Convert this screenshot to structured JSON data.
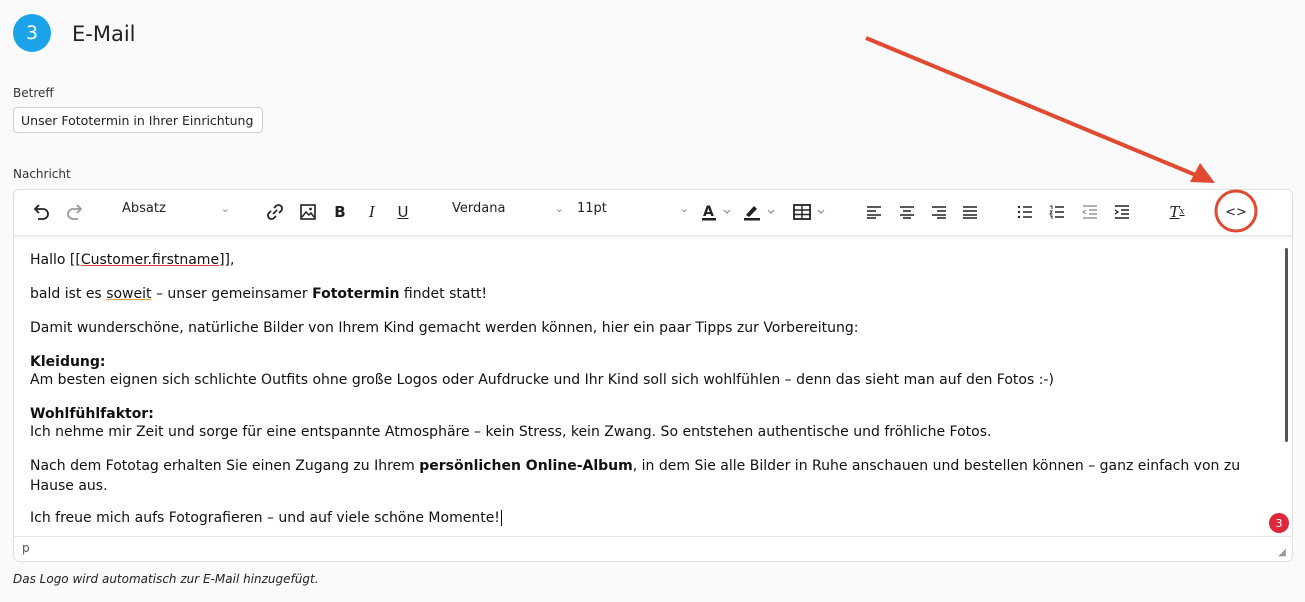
{
  "step": {
    "number": "3",
    "title": "E-Mail"
  },
  "subject": {
    "label": "Betreff",
    "value": "Unser Fototermin in Ihrer Einrichtung"
  },
  "message": {
    "label": "Nachricht",
    "toolbar": {
      "block_format": "Absatz",
      "font_family": "Verdana",
      "font_size": "11pt",
      "icons": [
        "undo-icon",
        "redo-icon",
        "link-icon",
        "image-icon",
        "bold-icon",
        "italic-icon",
        "underline-icon",
        "text-color-icon",
        "highlight-color-icon",
        "table-icon",
        "align-left-icon",
        "align-center-icon",
        "align-right-icon",
        "align-justify-icon",
        "bullet-list-icon",
        "numbered-list-icon",
        "outdent-icon",
        "indent-icon",
        "clear-formatting-icon",
        "source-code-icon"
      ]
    },
    "body": {
      "greeting_pre": "Hallo [[",
      "greeting_var": "Customer.firstname",
      "greeting_post": "]],",
      "p2_pre": "bald ist es ",
      "p2_word": "soweit",
      "p2_mid": " – unser gemeinsamer ",
      "p2_bold": "Fototermin",
      "p2_post": " findet statt!",
      "p3": "Damit wunderschöne, natürliche Bilder von Ihrem Kind gemacht werden können, hier ein paar Tipps zur Vorbereitung:",
      "h1": "Kleidung:",
      "p4": "Am besten eignen sich schlichte Outfits ohne große Logos oder Aufdrucke und Ihr Kind soll sich wohlfühlen – denn das sieht man auf den Fotos :-)",
      "h2": "Wohlfühlfaktor:",
      "p5": "Ich nehme mir Zeit und sorge für eine entspannte Atmosphäre – kein Stress, kein Zwang. So entstehen authentische und fröhliche Fotos.",
      "p6_pre": "Nach dem Fototag erhalten Sie einen Zugang zu Ihrem ",
      "p6_bold": "persönlichen Online-Album",
      "p6_post": ", in dem Sie alle Bilder in Ruhe anschauen und bestellen können – ganz einfach von zu Hause aus.",
      "p7": "Ich freue mich aufs Fotografieren – und auf viele schöne Momente!"
    },
    "status_path": "p",
    "notification_count": "3"
  },
  "footer_hint": "Das Logo wird automatisch zur E-Mail hinzugefügt.",
  "colors": {
    "accent": "#1aa3e8",
    "annotation": "#e04a32",
    "badge": "#e0283c"
  }
}
